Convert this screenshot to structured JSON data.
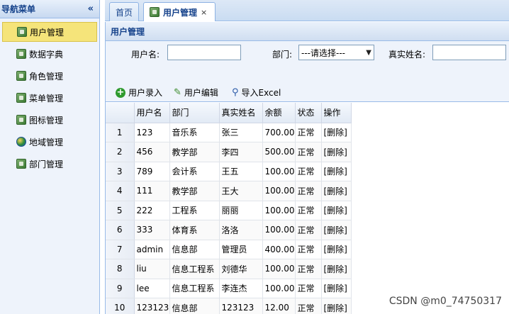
{
  "sidebar": {
    "title": "导航菜单",
    "collapse_icon": "«",
    "items": [
      {
        "label": "用户管理",
        "icon": "leaf",
        "active": true
      },
      {
        "label": "数据字典",
        "icon": "leaf",
        "active": false
      },
      {
        "label": "角色管理",
        "icon": "leaf",
        "active": false
      },
      {
        "label": "菜单管理",
        "icon": "leaf",
        "active": false
      },
      {
        "label": "图标管理",
        "icon": "leaf",
        "active": false
      },
      {
        "label": "地域管理",
        "icon": "globe",
        "active": false
      },
      {
        "label": "部门管理",
        "icon": "leaf",
        "active": false
      }
    ]
  },
  "tabs": {
    "home": "首页",
    "active": "用户管理",
    "close": "×"
  },
  "panel": {
    "title": "用户管理"
  },
  "search": {
    "username_label": "用户名:",
    "username_value": "",
    "dept_label": "部门:",
    "dept_selected": "---请选择---",
    "realname_label": "真实姓名:",
    "realname_value": ""
  },
  "actions": {
    "add": "用户录入",
    "edit": "用户编辑",
    "import": "导入Excel"
  },
  "table": {
    "columns": [
      "",
      "用户名",
      "部门",
      "真实姓名",
      "余额",
      "状态",
      "操作"
    ],
    "rows": [
      {
        "n": "1",
        "user": "123",
        "dept": "音乐系",
        "name": "张三",
        "balance": "700.00",
        "status": "正常",
        "op": "[删除]"
      },
      {
        "n": "2",
        "user": "456",
        "dept": "教学部",
        "name": "李四",
        "balance": "500.00",
        "status": "正常",
        "op": "[删除]"
      },
      {
        "n": "3",
        "user": "789",
        "dept": "会计系",
        "name": "王五",
        "balance": "100.00",
        "status": "正常",
        "op": "[删除]"
      },
      {
        "n": "4",
        "user": "111",
        "dept": "教学部",
        "name": "王大",
        "balance": "100.00",
        "status": "正常",
        "op": "[删除]"
      },
      {
        "n": "5",
        "user": "222",
        "dept": "工程系",
        "name": "丽丽",
        "balance": "100.00",
        "status": "正常",
        "op": "[删除]"
      },
      {
        "n": "6",
        "user": "333",
        "dept": "体育系",
        "name": "洛洛",
        "balance": "100.00",
        "status": "正常",
        "op": "[删除]"
      },
      {
        "n": "7",
        "user": "admin",
        "dept": "信息部",
        "name": "管理员",
        "balance": "400.00",
        "status": "正常",
        "op": "[删除]"
      },
      {
        "n": "8",
        "user": "liu",
        "dept": "信息工程系",
        "name": "刘德华",
        "balance": "100.00",
        "status": "正常",
        "op": "[删除]"
      },
      {
        "n": "9",
        "user": "lee",
        "dept": "信息工程系",
        "name": "李连杰",
        "balance": "100.00",
        "status": "正常",
        "op": "[删除]"
      },
      {
        "n": "10",
        "user": "123123",
        "dept": "信息部",
        "name": "123123",
        "balance": "12.00",
        "status": "正常",
        "op": "[删除]"
      }
    ]
  },
  "watermark": "CSDN @m0_74750317"
}
